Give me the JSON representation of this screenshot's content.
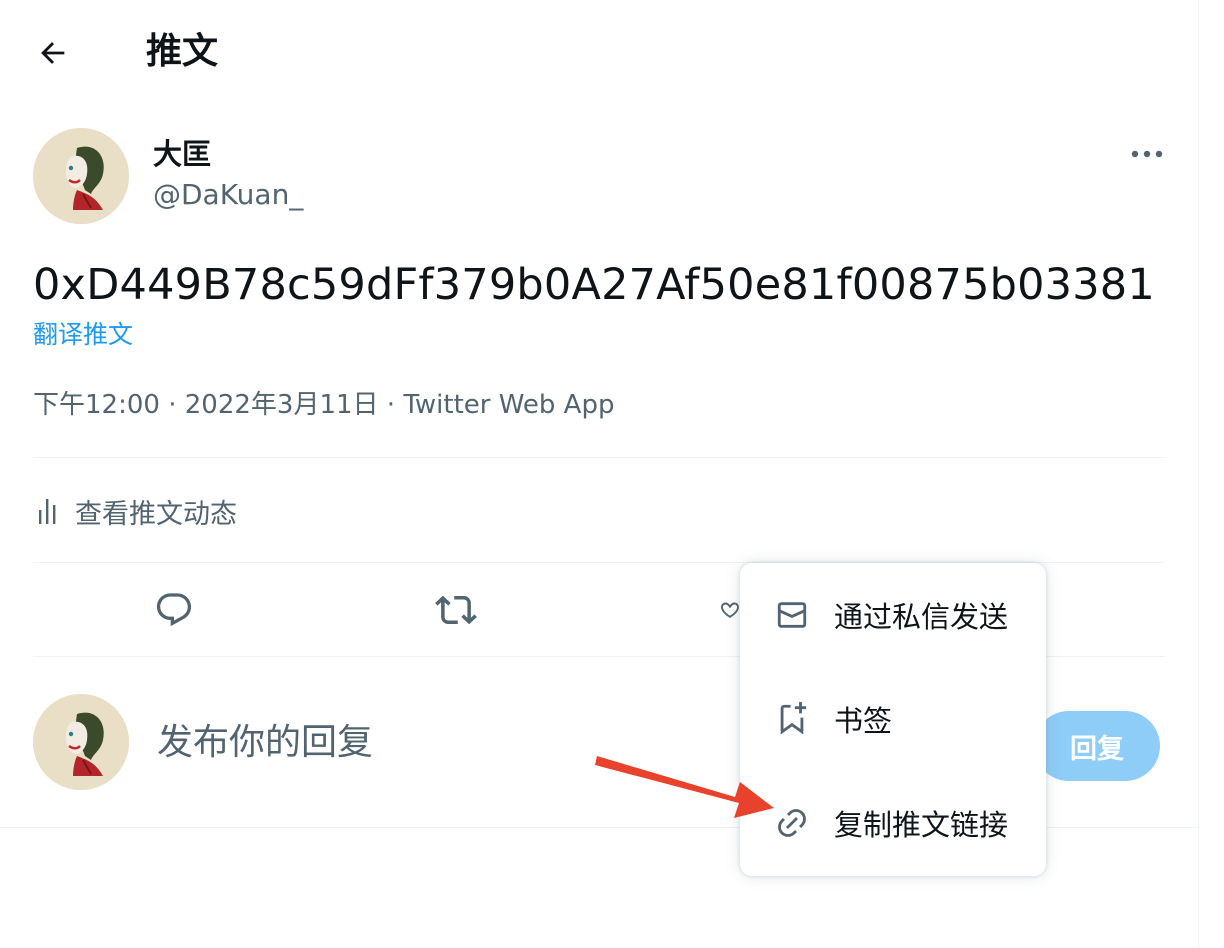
{
  "header": {
    "title": "推文"
  },
  "author": {
    "display_name": "大匡",
    "handle": "@DaKuan_"
  },
  "tweet": {
    "text": "0xD449B78c59dFf379b0A27Af50e81f00875b03381",
    "translate_label": "翻译推文",
    "time": "下午12:00",
    "separator": "·",
    "date": "2022年3月11日",
    "source": "Twitter Web App"
  },
  "analytics": {
    "label": "查看推文动态"
  },
  "actions": {
    "icons": [
      "reply-icon",
      "retweet-icon",
      "like-icon"
    ]
  },
  "reply": {
    "placeholder": "发布你的回复",
    "button_label": "回复"
  },
  "share_menu": {
    "items": [
      {
        "label": "通过私信发送",
        "icon": "mail-icon"
      },
      {
        "label": "书签",
        "icon": "bookmark-add-icon"
      },
      {
        "label": "复制推文链接",
        "icon": "link-icon"
      }
    ]
  },
  "colors": {
    "link_blue": "#1d9bf0",
    "reply_button_disabled": "#8ecdf8",
    "annotation_arrow": "#e8412c",
    "secondary_text": "#536471"
  }
}
